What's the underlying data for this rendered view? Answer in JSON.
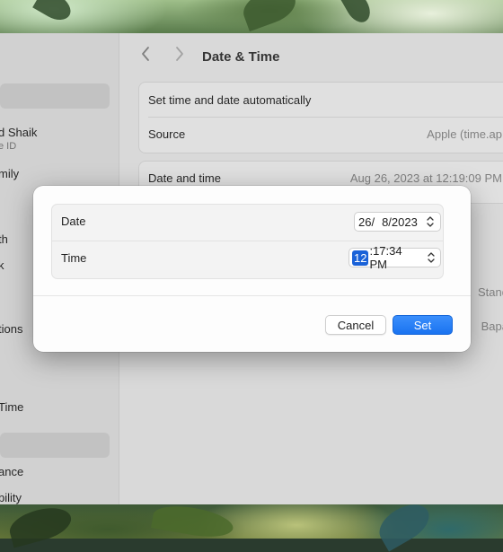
{
  "window": {
    "title": "Date & Time",
    "nav": {
      "back_icon": "chevron-left-icon",
      "forward_icon": "chevron-right-icon"
    }
  },
  "sidebar": {
    "items": [
      {
        "label": "d Shaik",
        "sublabel": "e ID"
      },
      {
        "label": "mily"
      },
      {
        "label": "th"
      },
      {
        "label": "k"
      },
      {
        "label": "tions"
      },
      {
        "label": "Time"
      },
      {
        "label": "ance"
      },
      {
        "label": "bility"
      }
    ]
  },
  "settings": {
    "auto_group": {
      "set_automatically_label": "Set time and date automatically",
      "source_label": "Source",
      "source_value": "Apple (time.ap"
    },
    "date_group": {
      "date_time_label": "Date and time",
      "date_time_value": "Aug 26, 2023 at 12:19:09 PM"
    },
    "partial_values": [
      "Stand",
      "Bapa"
    ]
  },
  "dialog": {
    "date_label": "Date",
    "date_value": {
      "day": "26/",
      "month": "8/2023"
    },
    "time_label": "Time",
    "time_value": {
      "hour": "12",
      "rest": ":17:34 PM"
    },
    "cancel_label": "Cancel",
    "set_label": "Set"
  },
  "colors": {
    "accent": "#1a73f0",
    "selection": "#1a62d8",
    "window_bg": "#ececec",
    "sidebar_bg": "#e3e3e3",
    "dialog_bg": "#fdfdfd"
  }
}
